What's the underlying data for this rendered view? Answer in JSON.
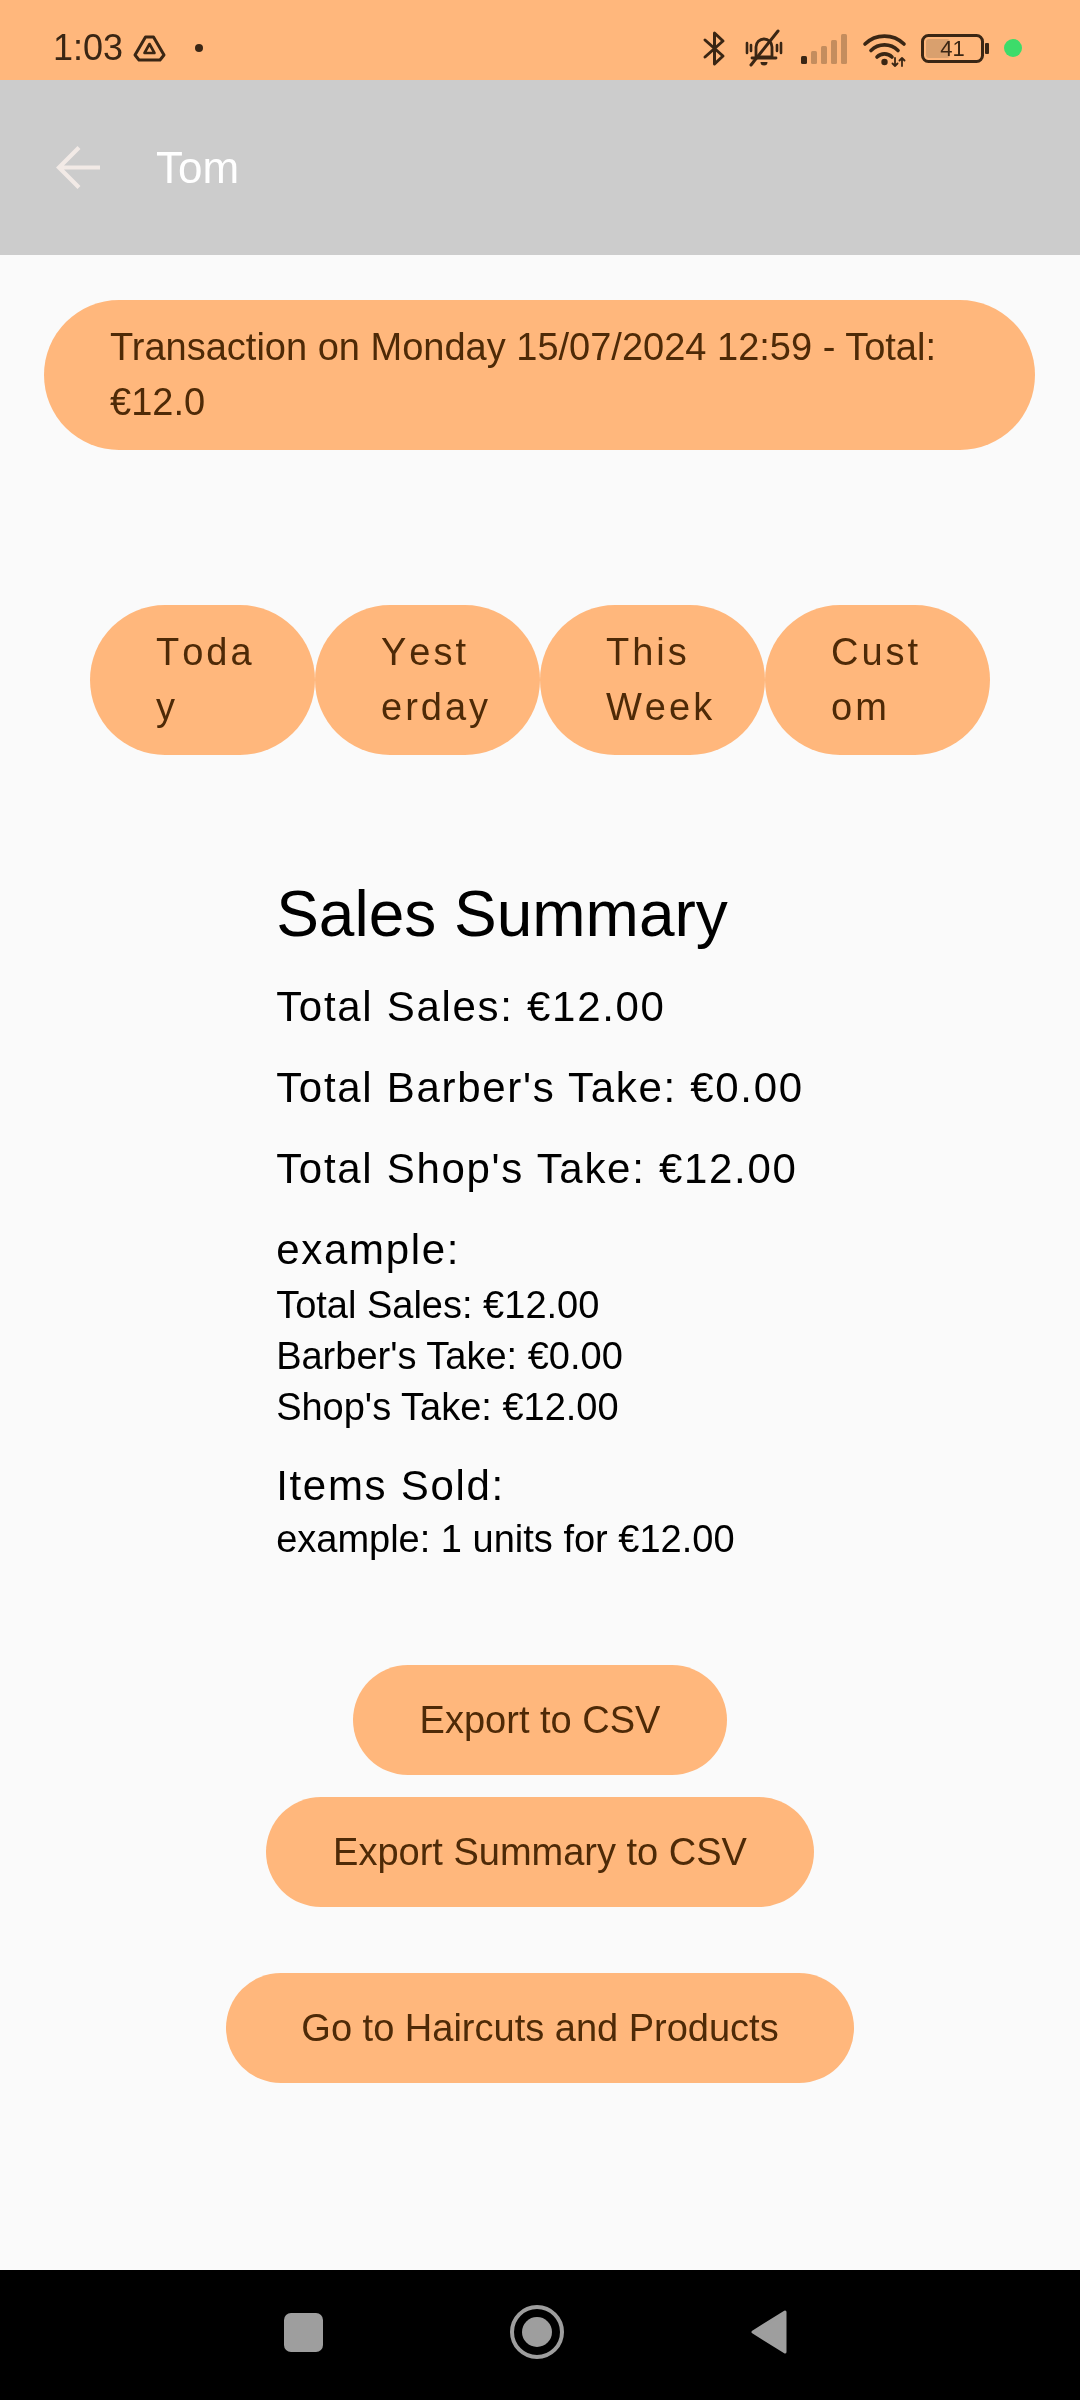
{
  "status_bar": {
    "time": "1:03",
    "battery": "41"
  },
  "app_bar": {
    "title": "Tom"
  },
  "transaction": {
    "label": "Transaction on Monday 15/07/2024 12:59 - Total: €12.0"
  },
  "filters": [
    {
      "label": "Today"
    },
    {
      "label": "Yesterday"
    },
    {
      "label": "This Week"
    },
    {
      "label": "Custom"
    }
  ],
  "summary": {
    "title": "Sales Summary",
    "totals": [
      "Total Sales: €12.00",
      "Total Barber's Take: €0.00",
      "Total Shop's Take: €12.00"
    ],
    "barbers": [
      {
        "name": "example:",
        "lines": [
          "Total Sales: €12.00",
          "Barber's Take: €0.00",
          "Shop's Take: €12.00"
        ]
      }
    ],
    "items_heading": "Items Sold:",
    "items": [
      "example: 1 units for €12.00"
    ]
  },
  "export_buttons": [
    "Export to CSV",
    "Export Summary to CSV"
  ],
  "navigation_button": "Go to Haircuts and Products"
}
